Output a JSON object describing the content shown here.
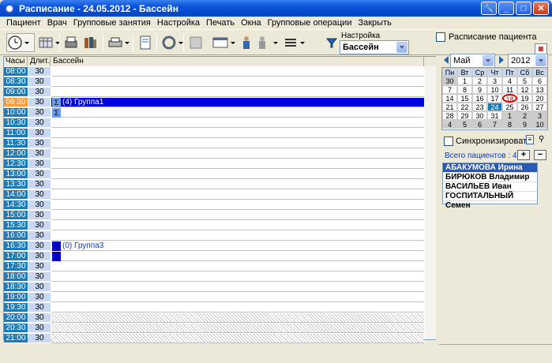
{
  "window": {
    "title": "Расписание - 24.05.2012 - Бассейн"
  },
  "menu": [
    "Пациент",
    "Врач",
    "Групповые занятия",
    "Настройка",
    "Печать",
    "Окна",
    "Групповые операции",
    "Закрыть"
  ],
  "toolbar": {
    "settings_label": "Настройка",
    "settings_value": "Бассейн",
    "patient_schedule_label": "Расписание пациента"
  },
  "grid": {
    "headers": {
      "hours": "Часы",
      "duration": "Длит.",
      "resource": "Бассейн"
    },
    "rows": [
      {
        "time": "08:00",
        "dur": "30"
      },
      {
        "time": "08:30",
        "dur": "30"
      },
      {
        "time": "09:00",
        "dur": "30"
      },
      {
        "time": "09:30",
        "dur": "30",
        "current": true,
        "group": "(4) Группа1"
      },
      {
        "time": "10:00",
        "dur": "30",
        "sigma": true
      },
      {
        "time": "10:30",
        "dur": "30"
      },
      {
        "time": "11:00",
        "dur": "30"
      },
      {
        "time": "11:30",
        "dur": "30"
      },
      {
        "time": "12:00",
        "dur": "30"
      },
      {
        "time": "12:30",
        "dur": "30"
      },
      {
        "time": "13:00",
        "dur": "30"
      },
      {
        "time": "13:30",
        "dur": "30"
      },
      {
        "time": "14:00",
        "dur": "30"
      },
      {
        "time": "14:30",
        "dur": "30"
      },
      {
        "time": "15:00",
        "dur": "30"
      },
      {
        "time": "15:30",
        "dur": "30"
      },
      {
        "time": "16:00",
        "dur": "30"
      },
      {
        "time": "16:30",
        "dur": "30",
        "group": "(0) Группа3"
      },
      {
        "time": "17:00",
        "dur": "30",
        "block": true
      },
      {
        "time": "17:30",
        "dur": "30"
      },
      {
        "time": "18:00",
        "dur": "30"
      },
      {
        "time": "18:30",
        "dur": "30"
      },
      {
        "time": "19:00",
        "dur": "30"
      },
      {
        "time": "19:30",
        "dur": "30"
      },
      {
        "time": "20:00",
        "dur": "30",
        "hatch": true
      },
      {
        "time": "20:30",
        "dur": "30",
        "hatch": true
      },
      {
        "time": "21:00",
        "dur": "30",
        "hatch": true
      }
    ]
  },
  "calendar": {
    "month": "Май",
    "year": "2012",
    "weekdays": [
      "Пн",
      "Вт",
      "Ср",
      "Чт",
      "Пт",
      "Сб",
      "Вс"
    ],
    "weeks": [
      [
        "30",
        "1",
        "2",
        "3",
        "4",
        "5",
        "6"
      ],
      [
        "7",
        "8",
        "9",
        "10",
        "11",
        "12",
        "13"
      ],
      [
        "14",
        "15",
        "16",
        "17",
        "18",
        "19",
        "20"
      ],
      [
        "21",
        "22",
        "23",
        "24",
        "25",
        "26",
        "27"
      ],
      [
        "28",
        "29",
        "30",
        "31",
        "1",
        "2",
        "3"
      ],
      [
        "4",
        "5",
        "6",
        "7",
        "8",
        "9",
        "10"
      ]
    ],
    "selected": "24",
    "today": "18"
  },
  "sync_label": "Синхронизировать",
  "patients": {
    "total_label": "Всего пациентов : 4",
    "items": [
      "АБАКУМОВА Ирина",
      "БИРЮКОВ Владимир",
      "ВАСИЛЬЕВ Иван",
      "ГОСПИТАЛЬНЫЙ Семен"
    ]
  }
}
